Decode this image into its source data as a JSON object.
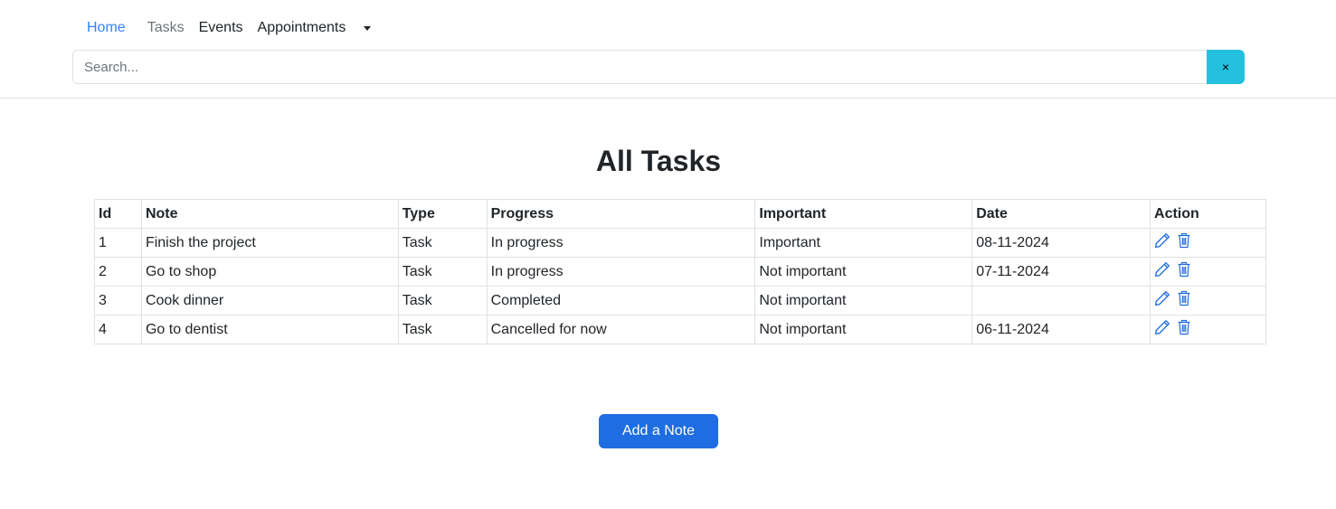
{
  "nav": {
    "items": [
      {
        "label": "Home"
      },
      {
        "label": "Tasks"
      },
      {
        "label": "Events"
      },
      {
        "label": "Appointments"
      }
    ],
    "dropdown_icon": "caret-down-icon"
  },
  "search": {
    "placeholder": "Search...",
    "value": "",
    "clear_label": "×"
  },
  "main": {
    "title": "All Tasks",
    "table": {
      "headers": [
        "Id",
        "Note",
        "Type",
        "Progress",
        "Important",
        "Date",
        "Action"
      ],
      "rows": [
        {
          "id": "1",
          "note": "Finish the project",
          "type": "Task",
          "progress": "In progress",
          "important": "Important",
          "date": "08-11-2024"
        },
        {
          "id": "2",
          "note": "Go to shop",
          "type": "Task",
          "progress": "In progress",
          "important": "Not important",
          "date": "07-11-2024"
        },
        {
          "id": "3",
          "note": "Cook dinner",
          "type": "Task",
          "progress": "Completed",
          "important": "Not important",
          "date": ""
        },
        {
          "id": "4",
          "note": "Go to dentist",
          "type": "Task",
          "progress": "Cancelled for now",
          "important": "Not important",
          "date": "06-11-2024"
        }
      ],
      "action_icons": [
        "pencil-icon",
        "trash-icon"
      ]
    },
    "add_button_label": "Add a Note"
  },
  "colors": {
    "primary": "#1f6de0",
    "info": "#25c0e0",
    "link": "#0d6efd",
    "muted": "#6c757d",
    "border": "#dee2e6"
  }
}
